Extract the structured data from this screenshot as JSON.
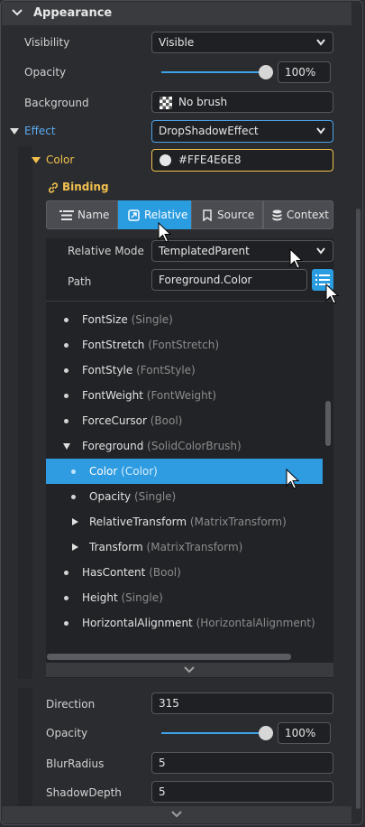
{
  "header": {
    "title": "Appearance"
  },
  "props": {
    "visibility": {
      "label": "Visibility",
      "value": "Visible"
    },
    "opacity": {
      "label": "Opacity",
      "value": "100%",
      "level": 1.0
    },
    "background": {
      "label": "Background",
      "value": "No brush"
    },
    "effect": {
      "label": "Effect",
      "value": "DropShadowEffect"
    },
    "color": {
      "label": "Color",
      "value": "#FFE4E6E8"
    }
  },
  "binding": {
    "title": "Binding",
    "tabs": [
      {
        "label": "Name",
        "icon": "list-icon"
      },
      {
        "label": "Relative",
        "icon": "relative-icon",
        "active": true
      },
      {
        "label": "Source",
        "icon": "bookmark-icon"
      },
      {
        "label": "Context",
        "icon": "database-icon"
      }
    ],
    "relative_mode": {
      "label": "Relative Mode",
      "value": "TemplatedParent"
    },
    "path": {
      "label": "Path",
      "value": "Foreground.Color"
    }
  },
  "tree": [
    {
      "name": "FontSize",
      "type": "(Single)"
    },
    {
      "name": "FontStretch",
      "type": "(FontStretch)"
    },
    {
      "name": "FontStyle",
      "type": "(FontStyle)"
    },
    {
      "name": "FontWeight",
      "type": "(FontWeight)"
    },
    {
      "name": "ForceCursor",
      "type": "(Bool)"
    },
    {
      "name": "Foreground",
      "type": "(SolidColorBrush)"
    },
    {
      "name": "Color",
      "type": "(Color)"
    },
    {
      "name": "Opacity",
      "type": "(Single)"
    },
    {
      "name": "RelativeTransform",
      "type": "(MatrixTransform)"
    },
    {
      "name": "Transform",
      "type": "(MatrixTransform)"
    },
    {
      "name": "HasContent",
      "type": "(Bool)"
    },
    {
      "name": "Height",
      "type": "(Single)"
    },
    {
      "name": "HorizontalAlignment",
      "type": "(HorizontalAlignment)"
    }
  ],
  "shadow": {
    "direction": {
      "label": "Direction",
      "value": "315"
    },
    "opacity": {
      "label": "Opacity",
      "value": "100%",
      "level": 1.0
    },
    "blur_radius": {
      "label": "BlurRadius",
      "value": "5"
    },
    "shadow_depth": {
      "label": "ShadowDepth",
      "value": "5"
    }
  },
  "colors": {
    "accent": "#2a9ce0",
    "effect_text": "#5aaaf0",
    "color_accent": "#f2c14e",
    "swatch": "#E4E6E8"
  }
}
